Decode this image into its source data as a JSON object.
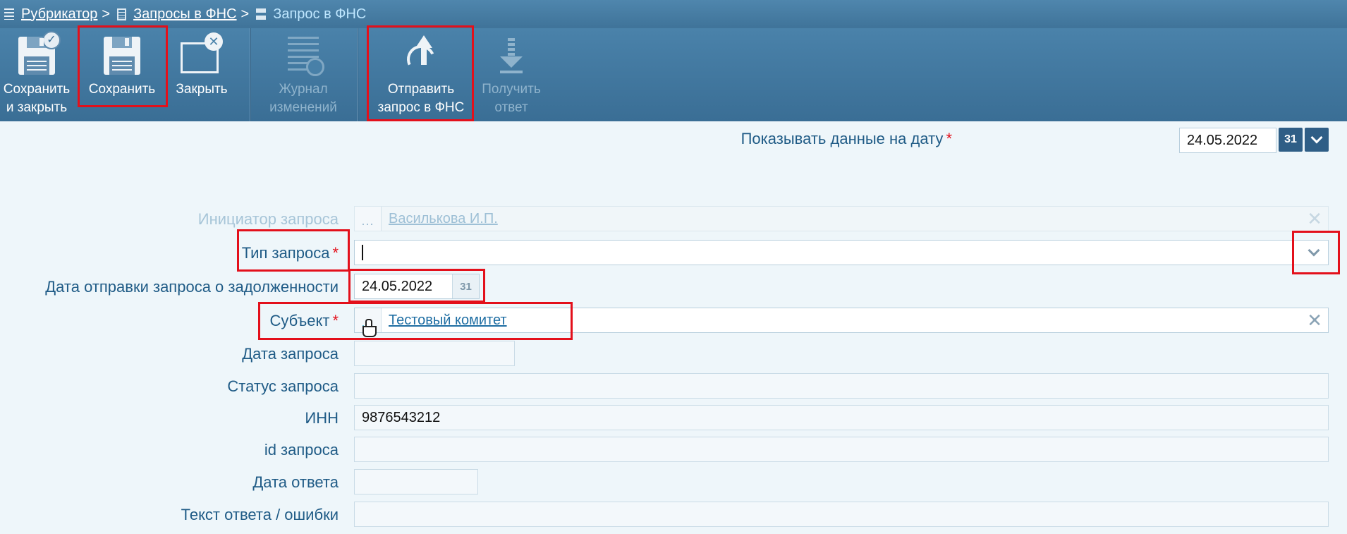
{
  "breadcrumb": {
    "items": [
      {
        "label": "Рубрикатор",
        "icon": "list-icon"
      },
      {
        "label": "Запросы в ФНС",
        "icon": "document-icon"
      }
    ],
    "separator": ">",
    "current": "Запрос в ФНС",
    "current_icon": "record-icon"
  },
  "toolbar": {
    "save_close": {
      "line1": "Сохранить",
      "line2": "и закрыть",
      "icon": "save-close-icon"
    },
    "save": {
      "line1": "Сохранить",
      "icon": "save-icon"
    },
    "close": {
      "line1": "Закрыть",
      "icon": "close-window-icon"
    },
    "journal": {
      "line1": "Журнал",
      "line2": "изменений",
      "icon": "journal-icon",
      "disabled": true
    },
    "send": {
      "line1": "Отправить",
      "line2": "запрос в ФНС",
      "icon": "send-request-icon"
    },
    "receive": {
      "line1": "Получить",
      "line2": "ответ",
      "icon": "download-icon",
      "disabled": true
    }
  },
  "date_filter": {
    "label": "Показывать данные на дату",
    "required_mark": "*",
    "value": "24.05.2022",
    "calendar_label": "31"
  },
  "form": {
    "initiator": {
      "label": "Инициатор запроса",
      "dots": "...",
      "value": "Василькова И.П.",
      "clear": "✕"
    },
    "request_type": {
      "label": "Тип запроса",
      "required_mark": "*",
      "value": ""
    },
    "send_date": {
      "label": "Дата отправки запроса о задолженности",
      "value": "24.05.2022",
      "calendar_label": "31"
    },
    "subject": {
      "label": "Субъект",
      "required_mark": "*",
      "dots": "...",
      "value": "Тестовый комитет",
      "clear": "✕"
    },
    "request_date": {
      "label": "Дата запроса",
      "value": ""
    },
    "request_status": {
      "label": "Статус запроса",
      "value": ""
    },
    "inn": {
      "label": "ИНН",
      "value": "9876543212"
    },
    "request_id": {
      "label": "id запроса",
      "value": ""
    },
    "answer_date": {
      "label": "Дата ответа",
      "value": ""
    },
    "answer_text": {
      "label": "Текст ответа / ошибки",
      "value": ""
    }
  },
  "colors": {
    "highlight": "#e3101b",
    "toolbar": "#3f7399",
    "accent_required": "#e3101b"
  }
}
